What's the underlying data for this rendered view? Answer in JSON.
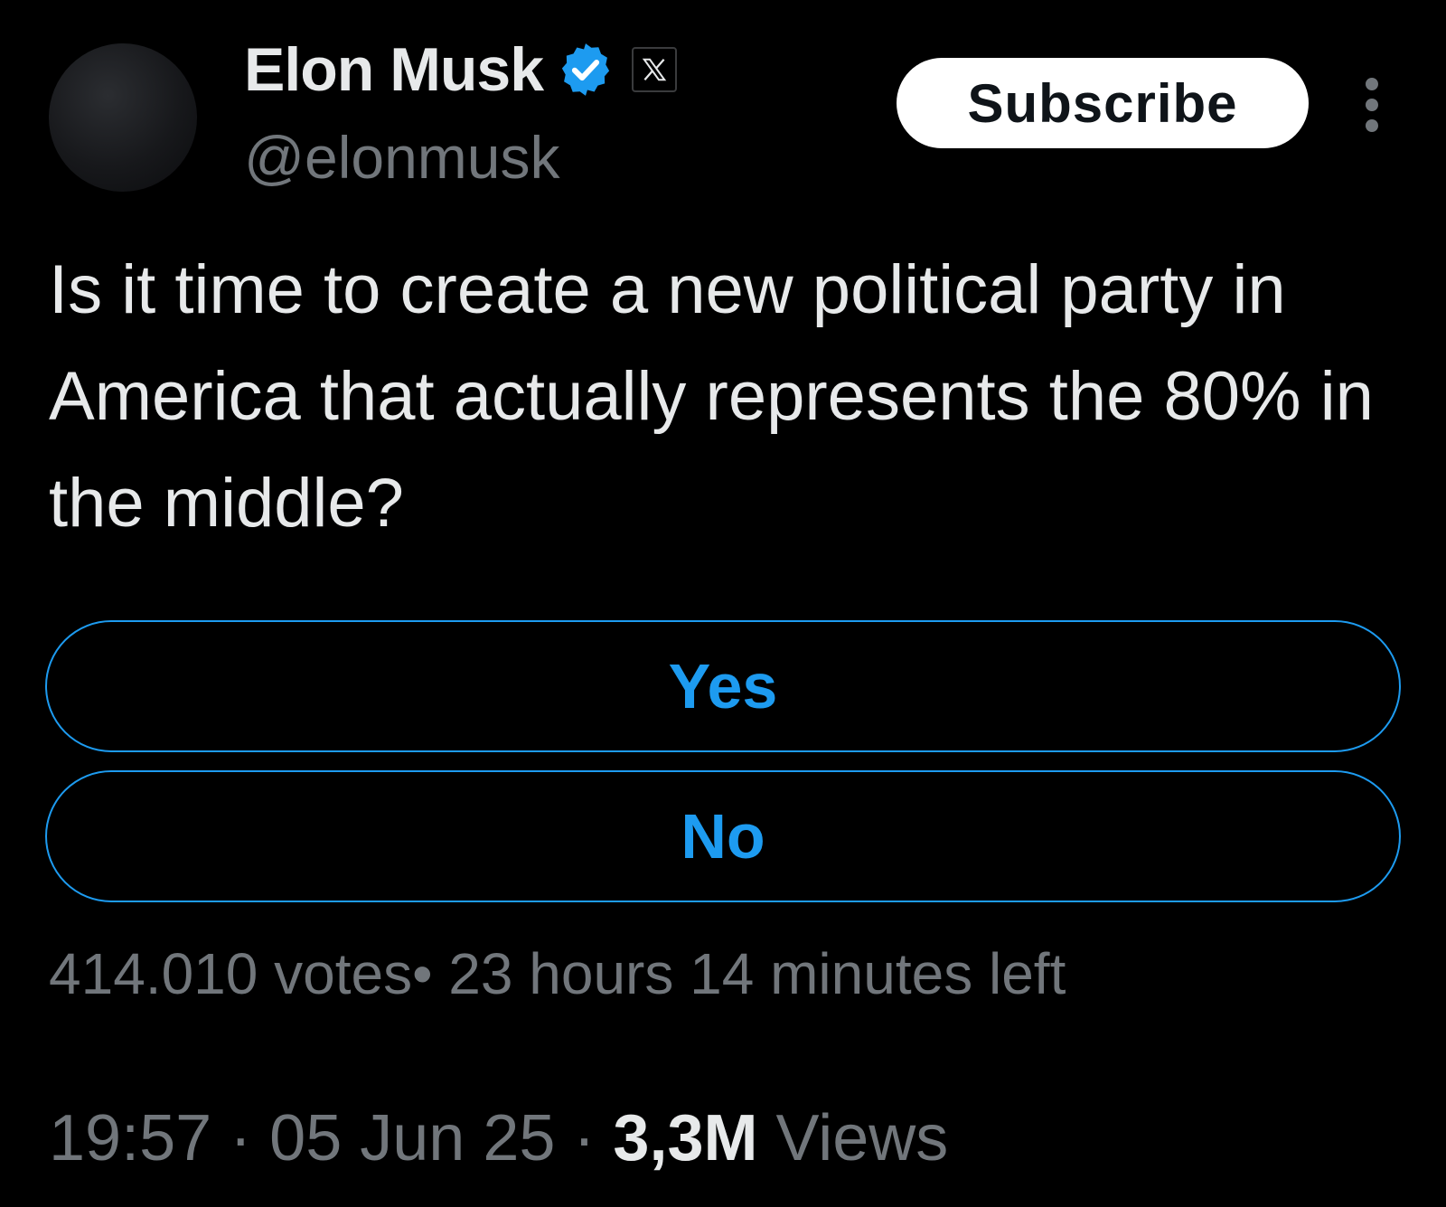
{
  "author": {
    "display_name": "Elon Musk",
    "handle": "@elonmusk",
    "verified_icon": "verified-badge-icon",
    "affiliation_icon": "x-logo-icon"
  },
  "header": {
    "subscribe_label": "Subscribe",
    "more_icon": "more-vertical-icon"
  },
  "tweet": {
    "text": "Is it time to create a new political party in America that actually represents the 80% in the middle?"
  },
  "poll": {
    "options": [
      {
        "label": "Yes"
      },
      {
        "label": "No"
      }
    ],
    "votes": "414.010 votes",
    "separator": "•",
    "time_left": "23 hours 14 minutes left"
  },
  "footer": {
    "time": "19:57",
    "date": "05 Jun 25",
    "views_count": "3,3M",
    "views_label": "Views"
  },
  "colors": {
    "background": "#000000",
    "accent": "#1d9bf0",
    "primary_text": "#e7e9ea",
    "secondary_text": "#71767b"
  }
}
